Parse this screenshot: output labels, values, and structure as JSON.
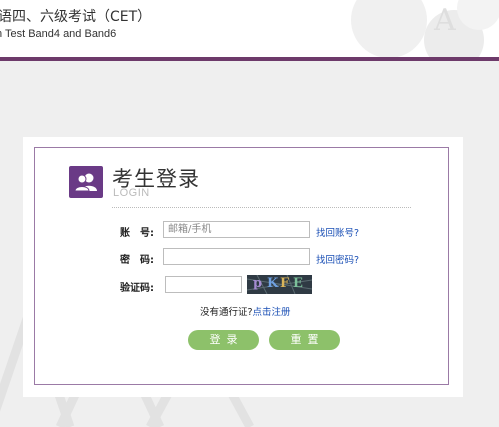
{
  "header": {
    "title_cn": "语四、六级考试（CET）",
    "title_en": "n Test Band4 and Band6",
    "deco_letter": "A"
  },
  "login": {
    "title": "考生登录",
    "subtitle": "LOGIN",
    "account_label": "账　号:",
    "account_placeholder": "邮箱/手机",
    "forgot_account": "找回账号?",
    "password_label": "密　码:",
    "password_value": "",
    "forgot_password": "找回密码?",
    "captcha_label": "验证码:",
    "captcha_value": "",
    "captcha_text": [
      "p",
      "K",
      "F",
      "E"
    ],
    "no_pass_text": "没有通行证?",
    "register_link": "点击注册",
    "login_button": "登录",
    "reset_button": "重置"
  },
  "colors": {
    "accent_bar": "#6d3a6a",
    "logo_bg": "#6a3a86",
    "button_green": "#8dc16a",
    "link_blue": "#1a4fb5"
  }
}
